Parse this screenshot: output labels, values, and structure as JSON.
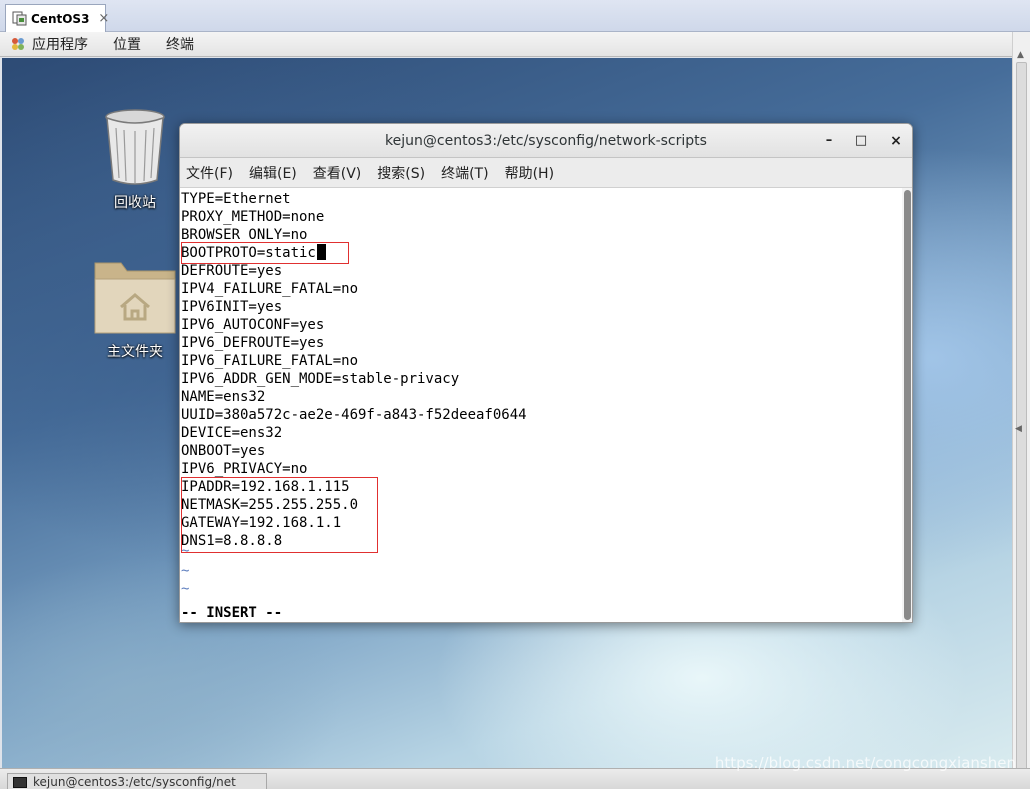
{
  "vm_tab": {
    "label": "CentOS3",
    "close": "×"
  },
  "top_panel": {
    "apps": "应用程序",
    "places": "位置",
    "terminal": "终端"
  },
  "desktop_icons": {
    "trash": "回收站",
    "home": "主文件夹"
  },
  "terminal": {
    "title": "kejun@centos3:/etc/sysconfig/network-scripts",
    "controls": {
      "minimize": "–",
      "maximize": "□",
      "close": "×"
    },
    "menu": [
      "文件(F)",
      "编辑(E)",
      "查看(V)",
      "搜索(S)",
      "终端(T)",
      "帮助(H)"
    ],
    "lines": [
      "TYPE=Ethernet",
      "PROXY_METHOD=none",
      "BROWSER_ONLY=no",
      "BOOTPROTO=static",
      "DEFROUTE=yes",
      "IPV4_FAILURE_FATAL=no",
      "IPV6INIT=yes",
      "IPV6_AUTOCONF=yes",
      "IPV6_DEFROUTE=yes",
      "IPV6_FAILURE_FATAL=no",
      "IPV6_ADDR_GEN_MODE=stable-privacy",
      "NAME=ens32",
      "UUID=380a572c-ae2e-469f-a843-f52deeaf0644",
      "DEVICE=ens32",
      "ONBOOT=yes",
      "IPV6_PRIVACY=no",
      "IPADDR=192.168.1.115",
      "NETMASK=255.255.255.0",
      "GATEWAY=192.168.1.1",
      "DNS1=8.8.8.8"
    ],
    "tildes": [
      "~",
      "~",
      "~"
    ],
    "mode": "-- INSERT --"
  },
  "taskbar": {
    "item": "kejun@centos3:/etc/sysconfig/net"
  },
  "watermark": "https://blog.csdn.net/congcongxianshen",
  "colors": {
    "highlight": "#e03030"
  }
}
